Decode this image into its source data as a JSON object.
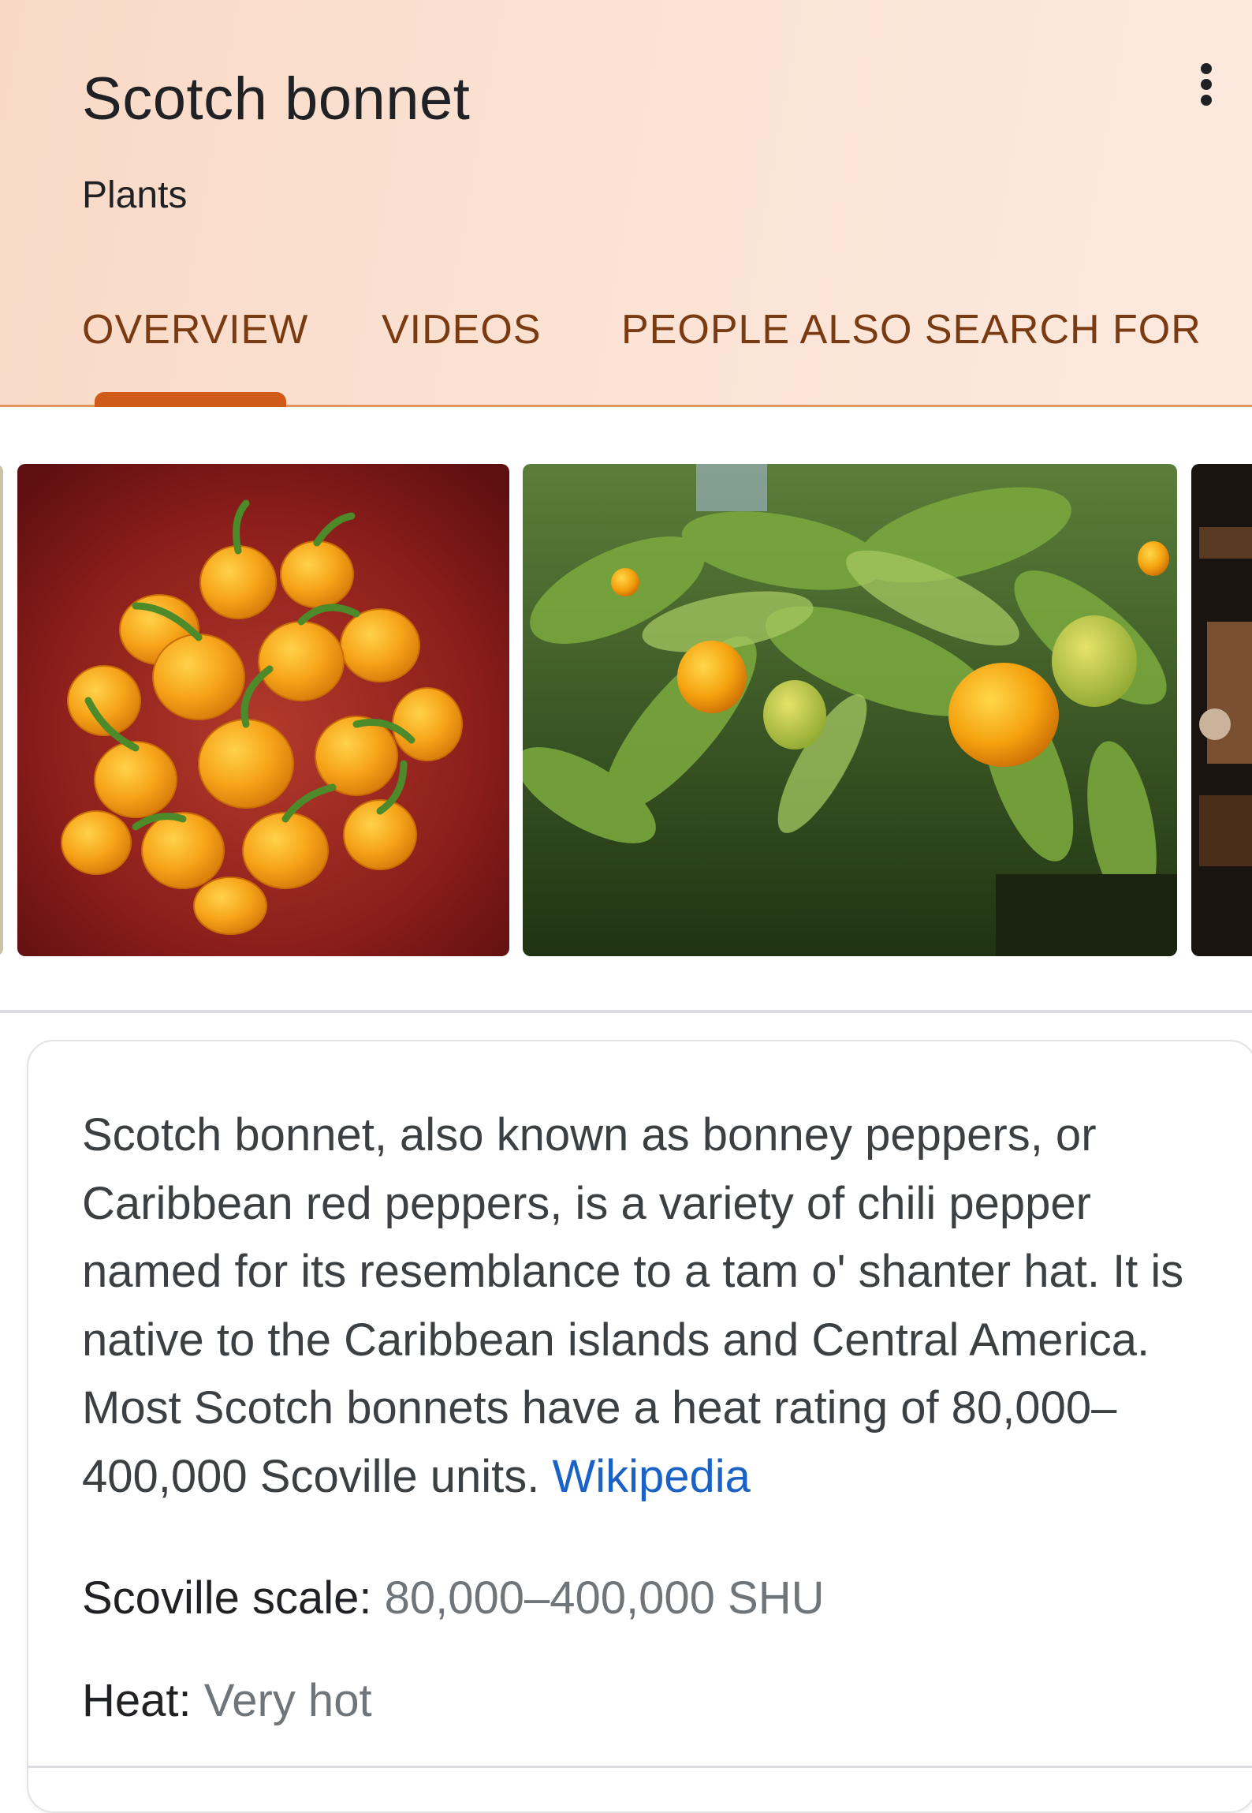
{
  "header": {
    "title": "Scotch bonnet",
    "subtitle": "Plants",
    "more_icon": "more-vertical-icon",
    "gradient_colors": [
      "#f9d9c6",
      "#fde9de"
    ],
    "accent_color": "#cf5a1a"
  },
  "tabs": [
    {
      "label": "OVERVIEW",
      "active": true
    },
    {
      "label": "VIDEOS",
      "active": false
    },
    {
      "label": "PEOPLE ALSO SEARCH FOR",
      "active": false
    }
  ],
  "images": [
    {
      "name": "bowl-of-yellow-peppers-image"
    },
    {
      "name": "pepper-plant-image"
    }
  ],
  "description": {
    "text": "Scotch bonnet, also known as bonney peppers, or Caribbean red peppers, is a variety of chili pepper named for its resemblance to a tam o' shanter hat. It is native to the Caribbean islands and Central America. Most Scotch bonnets have a heat rating of 80,000–400,000 Scoville units.",
    "source": "Wikipedia",
    "link_color": "#1a62c6"
  },
  "facts": [
    {
      "label": "Scoville scale:",
      "value": "80,000–400,000 SHU"
    },
    {
      "label": "Heat:",
      "value": "Very hot"
    }
  ]
}
